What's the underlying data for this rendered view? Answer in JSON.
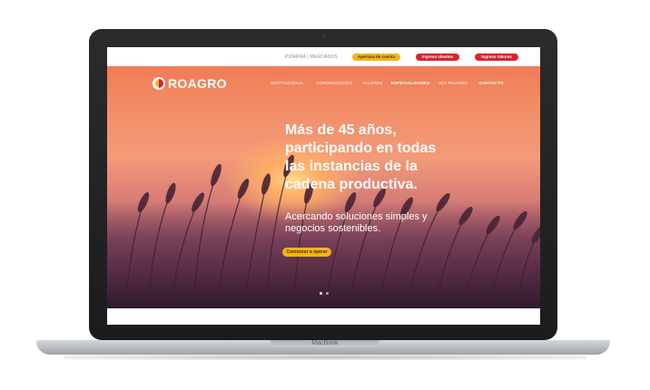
{
  "device": {
    "brand_label": "MacBook"
  },
  "topbar": {
    "link": "PIZARRA | MERCADOS",
    "buttons": [
      "Apertura de cuenta",
      "Ingreso clientes",
      "Ingreso Valores"
    ]
  },
  "site": {
    "logo_text": "ROAGRO",
    "nav": [
      "INSTITUCIONAL",
      "AGRONEGOCIOS",
      "VALORES",
      "ESPECIALIDADES",
      "BIO ROAGRO",
      "CONTACTO"
    ]
  },
  "hero": {
    "headline_lines": [
      "Más de 45 años,",
      "participando en todas",
      "las instancias de la",
      "cadena productiva."
    ],
    "sub_lines": [
      "Acercando soluciones simples y",
      "negocios sostenibles."
    ],
    "cta": "Comenzar a operar",
    "slide_count": 2,
    "active_slide": 1
  },
  "colors": {
    "accent_yellow": "#f2b518",
    "accent_red": "#d9232d"
  }
}
